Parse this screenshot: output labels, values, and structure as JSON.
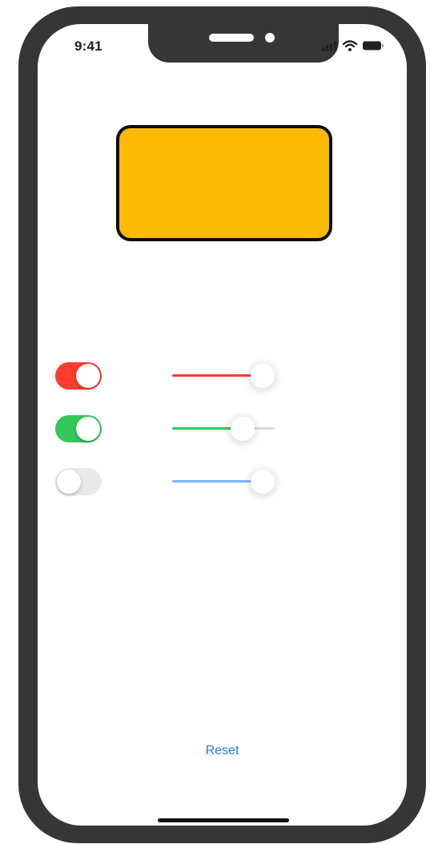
{
  "status_bar": {
    "time": "9:41",
    "icons": [
      "cellular-signal-icon",
      "wifi-icon",
      "battery-icon"
    ]
  },
  "preview": {
    "fill_color": "#fbba04",
    "border_color": "#0d0d0d"
  },
  "controls": [
    {
      "channel": "red",
      "toggle_on": true,
      "toggle_color": "#ff3b30",
      "slider_value": 0.88,
      "slider_color": "#ff3b30"
    },
    {
      "channel": "green",
      "toggle_on": true,
      "toggle_color": "#34c759",
      "slider_value": 0.69,
      "slider_color": "#34c759"
    },
    {
      "channel": "blue",
      "toggle_on": false,
      "toggle_color": "#e9e9ea",
      "slider_value": 0.88,
      "slider_color": "#7db6f2"
    }
  ],
  "reset_label": "Reset"
}
